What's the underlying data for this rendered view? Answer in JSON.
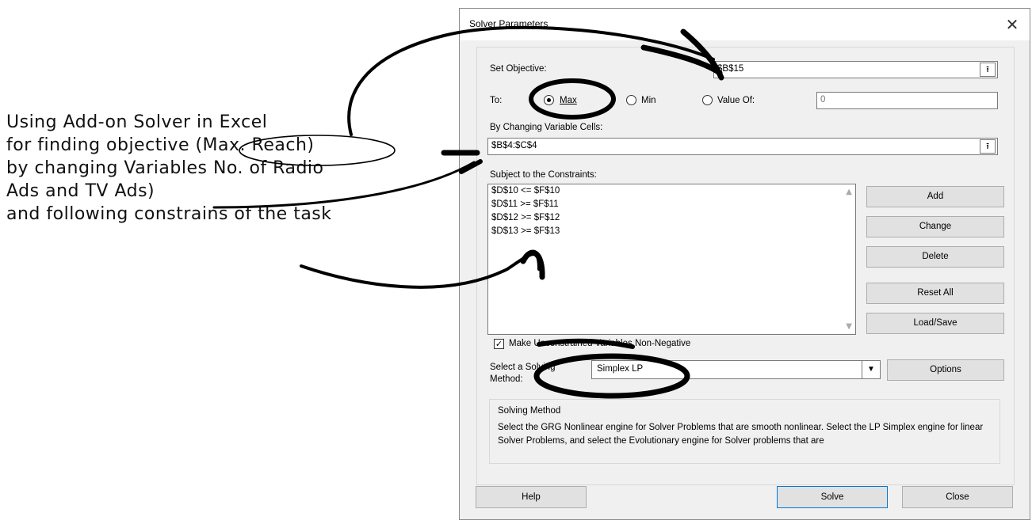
{
  "annotation": {
    "lines": [
      "Using Add-on Solver in Excel",
      "for finding objective (Max. Reach)",
      "by changing Variables No. of Radio",
      "Ads and TV Ads)",
      "and following constrains of the task"
    ]
  },
  "dialog": {
    "title": "Solver Parameters",
    "close_glyph": "✕",
    "set_objective_label": "Set Objective:",
    "objective_value": "$B$15",
    "to_label": "To:",
    "max_label": "Max",
    "min_label": "Min",
    "value_of_label": "Value Of:",
    "value_of_value": "0",
    "changing_cells_label": "By Changing Variable Cells:",
    "changing_cells_value": "$B$4:$C$4",
    "constraints_label": "Subject to the Constraints:",
    "constraints": [
      "$D$10 <= $F$10",
      "$D$11 >= $F$11",
      "$D$12 >= $F$12",
      "$D$13 >= $F$13"
    ],
    "add_label": "Add",
    "change_label": "Change",
    "delete_label": "Delete",
    "reset_label": "Reset All",
    "loadsave_label": "Load/Save",
    "nonneg_label": "Make Unconstrained Variables Non-Negative",
    "select_method_label_1": "Select a Solving",
    "select_method_label_2": "Method:",
    "method_value": "Simplex LP",
    "options_label": "Options",
    "method_box_title": "Solving Method",
    "method_description": "Select the GRG Nonlinear engine for Solver Problems that are smooth nonlinear. Select the LP Simplex engine for linear Solver Problems, and select the Evolutionary engine for Solver problems that are",
    "help_label": "Help",
    "solve_label": "Solve",
    "close_label": "Close",
    "collapse_glyph": "⭱"
  }
}
